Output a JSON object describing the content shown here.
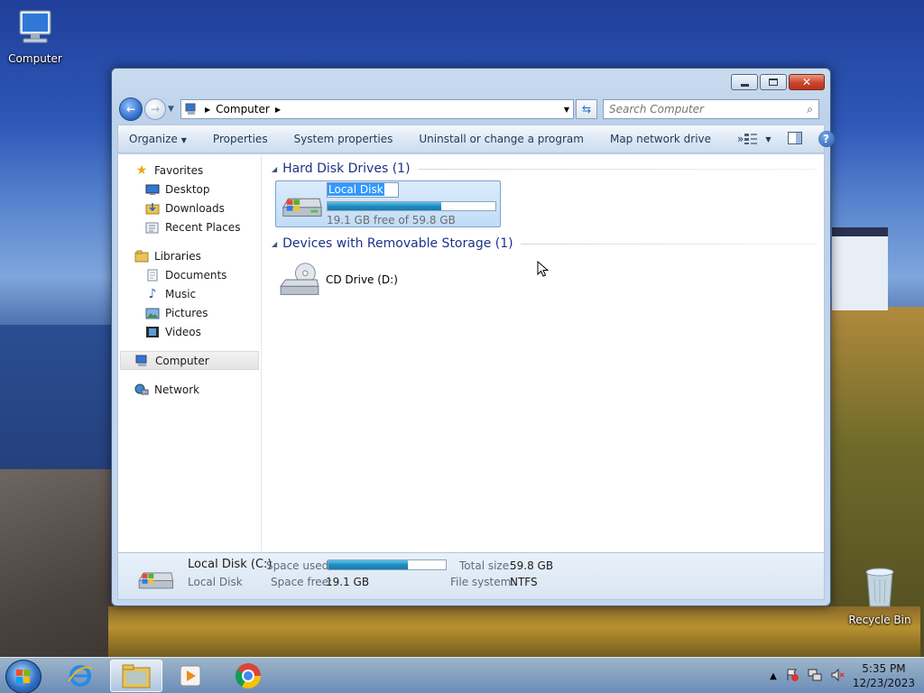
{
  "desktop": {
    "computer_label": "Computer",
    "recycle_label": "Recycle Bin"
  },
  "window": {
    "address": {
      "crumbs": [
        "Computer"
      ]
    },
    "search": {
      "placeholder": "Search Computer"
    },
    "commands": {
      "organize": "Organize",
      "properties": "Properties",
      "system_properties": "System properties",
      "uninstall": "Uninstall or change a program",
      "map_drive": "Map network drive",
      "more": "»"
    },
    "nav": {
      "favorites": "Favorites",
      "desktop": "Desktop",
      "downloads": "Downloads",
      "recent": "Recent Places",
      "libraries": "Libraries",
      "documents": "Documents",
      "music": "Music",
      "pictures": "Pictures",
      "videos": "Videos",
      "computer": "Computer",
      "network": "Network"
    },
    "groups": {
      "hdd": "Hard Disk Drives (1)",
      "removable": "Devices with Removable Storage (1)"
    },
    "local_disk": {
      "rename_value": "Local Disk",
      "free_text": "19.1 GB free of 59.8 GB",
      "used_fraction": 0.68
    },
    "cd_drive": {
      "label": "CD Drive (D:)"
    },
    "details": {
      "name": "Local Disk (C:)",
      "type": "Local Disk",
      "space_used_label": "Space used:",
      "space_free_label": "Space free:",
      "space_free": "19.1 GB",
      "total_size_label": "Total size:",
      "total_size": "59.8 GB",
      "fs_label": "File system:",
      "fs": "NTFS"
    }
  },
  "taskbar": {
    "time": "5:35 PM",
    "date": "12/23/2023"
  },
  "colors": {
    "accent": "#1e3287",
    "selection": "#c1dcf7",
    "capacity_bar": "#1f8cc0"
  }
}
